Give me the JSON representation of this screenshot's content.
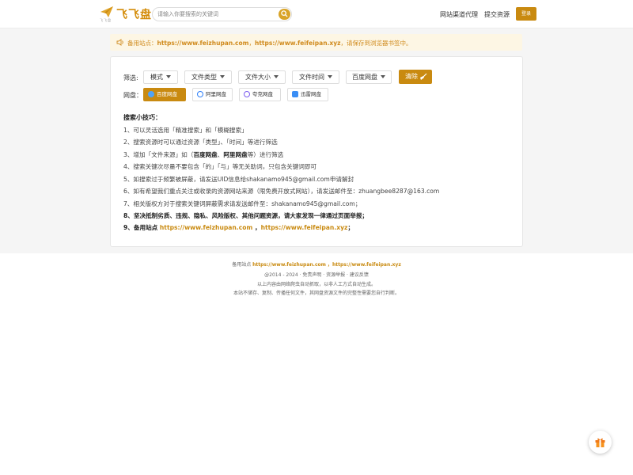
{
  "header": {
    "logo_name": "飞飞盘",
    "logo_sub": "飞飞盘",
    "search_placeholder": "请输入你要搜索的关键词",
    "nav": [
      "网站渠道代理",
      "提交资源"
    ],
    "login_label": "登录"
  },
  "notice": {
    "prefix": "备用站点：",
    "link1": "https://www.feizhupan.com",
    "sep": "，",
    "link2": "https://www.feifeipan.xyz",
    "suffix": "，请保存到浏览器书签中。"
  },
  "filters": {
    "label": "筛选:",
    "options": [
      "模式",
      "文件类型",
      "文件大小",
      "文件时间",
      "百度网盘"
    ],
    "clear_label": "清除",
    "pan_label": "网盘：",
    "pans": [
      {
        "label": "百度网盘",
        "active": true
      },
      {
        "label": "阿里网盘",
        "active": false
      },
      {
        "label": "夸克网盘",
        "active": false
      },
      {
        "label": "迅雷网盘",
        "active": false
      }
    ]
  },
  "tips": {
    "title": "搜索小技巧：",
    "t1": "1、可以灵活选用「精准搜索」和「模糊搜索」",
    "t2": "2、搜索资源时可以通过资源「类型」、「时间」等进行筛选",
    "t3_a": "3、增加「文件来源」如（",
    "t3_b": "百度网盘",
    "t3_c": "、",
    "t3_d": "阿里网盘",
    "t3_e": "等）进行筛选",
    "t4": "4、搜索关键次尽量不要包含「的」「与」等无关助词，只包含关键词即可",
    "t5": "5、如搜索过于频繁被屏蔽，请发送UID信息给shakanamo945@gmail.com申请解封",
    "t6": "6、如有希望我们重点关注或收录的资源网站来源（限免费开放式网站），请发送邮件至：zhuangbee8287@163.com",
    "t7": "7、相关版权方对于搜索关键词屏蔽需求请发送邮件至：shakanamo945@gmail.com；",
    "t8": "8、坚决抵制劣质、违规、隐私、风险版权、其他问题资源，请大家发现一律通过页面举报；",
    "t9_a": "9、备用站点 ",
    "t9_link1": "https://www.feizhupan.com",
    "t9_b": " ，",
    "t9_link2": "https://www.feifeipan.xyz",
    "t9_c": "；"
  },
  "footer": {
    "mirror_prefix": "备用站点 ",
    "mirror_link1": "https://www.feizhupan.com",
    "mirror_sep": " ，",
    "mirror_link2": "https://www.feifeipan.xyz",
    "links": "@2014 - 2024 · 免责声明 · 资源举报 · 建议反馈",
    "disclaimer1": "以上内容由网络爬虫自动抓取，以非人工方式自动生成。",
    "disclaimer2": "本站不储存、复制、传播任何文件，其网盘资源文件的完整性需要您自行判断。"
  },
  "colors": {
    "accent": "#c98a10",
    "notice_bg": "#fdf6e4",
    "notice_text": "#d08a1c"
  },
  "icons": [
    "logo-plane-icon",
    "search-icon",
    "speaker-icon",
    "caret-down-icon",
    "broom-icon",
    "baidu-icon",
    "aliyun-icon",
    "quark-icon",
    "xunlei-icon",
    "gift-icon"
  ]
}
